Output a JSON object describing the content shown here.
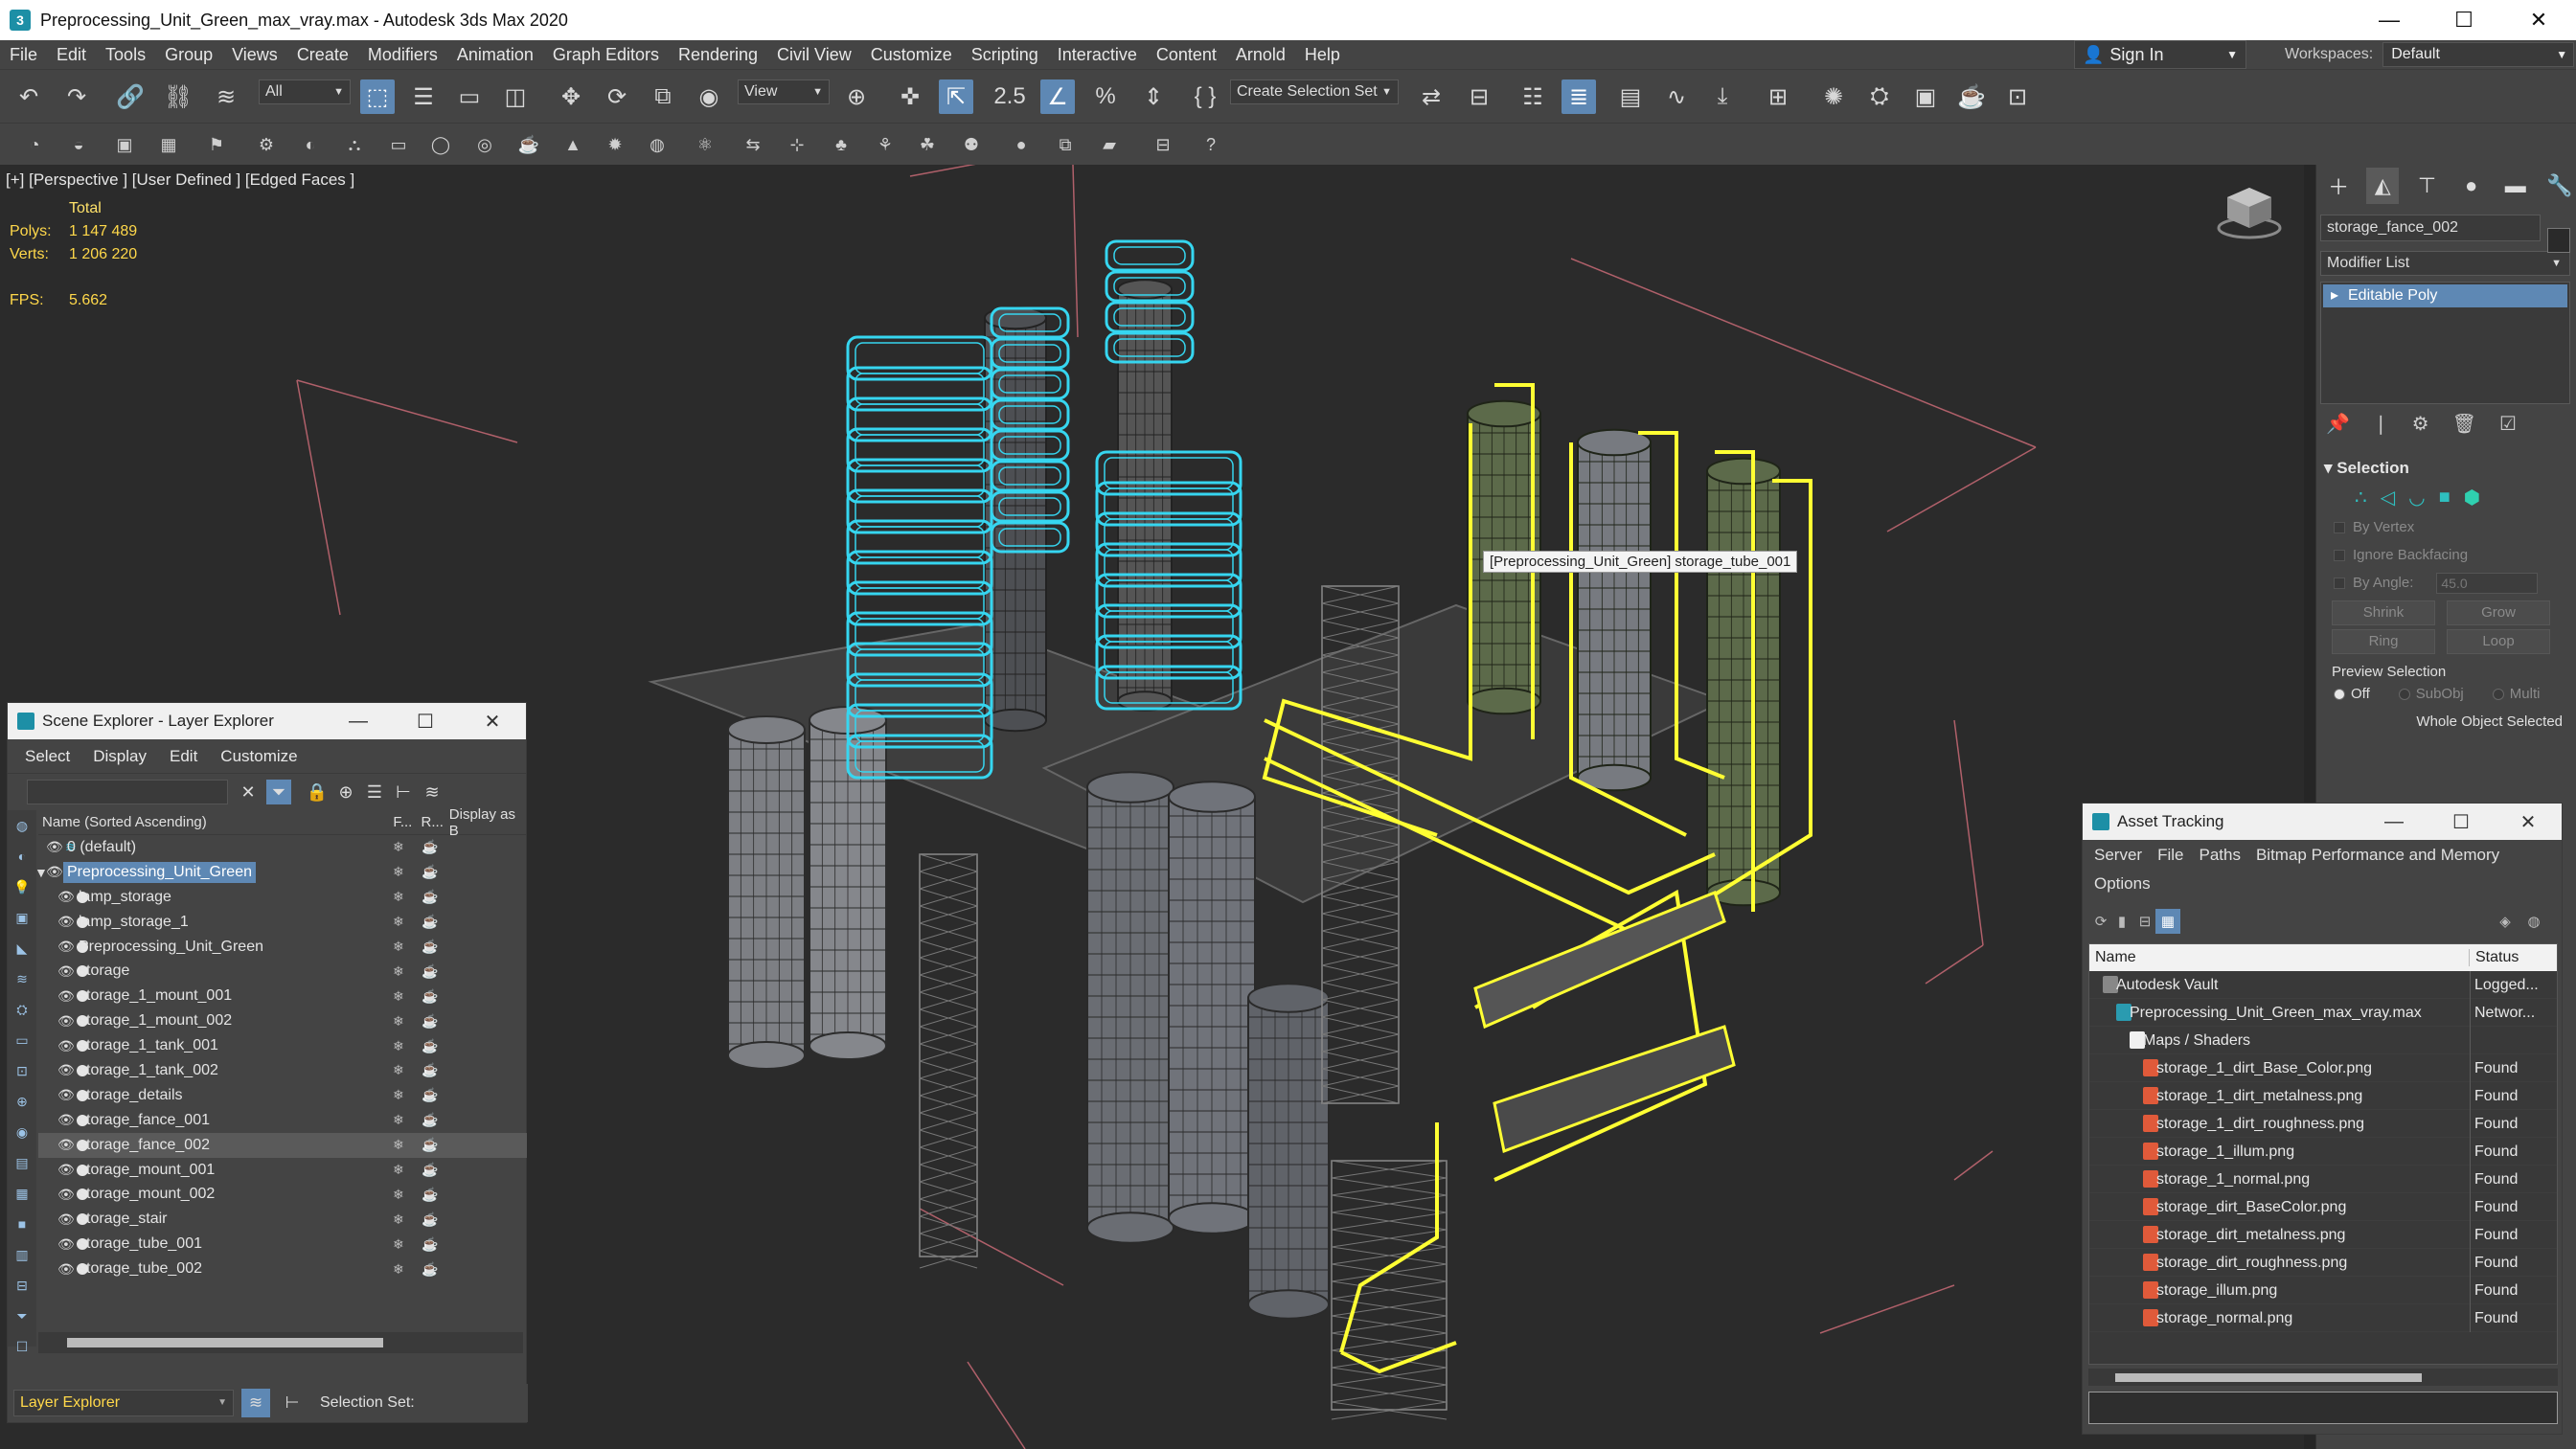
{
  "window": {
    "title": "Preprocessing_Unit_Green_max_vray.max - Autodesk 3ds Max 2020",
    "minimize": "—",
    "maximize": "☐",
    "close": "✕"
  },
  "menubar": {
    "items": [
      "File",
      "Edit",
      "Tools",
      "Group",
      "Views",
      "Create",
      "Modifiers",
      "Animation",
      "Graph Editors",
      "Rendering",
      "Civil View",
      "Customize",
      "Scripting",
      "Interactive",
      "Content",
      "Arnold",
      "Help"
    ],
    "sign_in": "Sign In",
    "workspaces_label": "Workspaces:",
    "workspaces_value": "Default"
  },
  "toolbar": {
    "filter_value": "All",
    "view_value": "View",
    "selection_set_placeholder": "Create Selection Set"
  },
  "viewport": {
    "label": "[+] [Perspective ] [User Defined ] [Edged Faces ]",
    "stats_header": "Total",
    "polys_label": "Polys:",
    "polys_value": "1 147 489",
    "verts_label": "Verts:",
    "verts_value": "1 206 220",
    "fps_label": "FPS:",
    "fps_value": "5.662",
    "tooltip": "[Preprocessing_Unit_Green] storage_tube_001"
  },
  "command_panel": {
    "object_name": "storage_fance_002",
    "modifier_list": "Modifier List",
    "stack_item": "Editable Poly",
    "selection_title": "Selection",
    "by_vertex": "By Vertex",
    "ignore_backfacing": "Ignore Backfacing",
    "by_angle": "By Angle:",
    "by_angle_value": "45.0",
    "shrink": "Shrink",
    "grow": "Grow",
    "ring": "Ring",
    "loop": "Loop",
    "preview_selection": "Preview Selection",
    "preview_off": "Off",
    "preview_subobj": "SubObj",
    "preview_multi": "Multi",
    "whole_object": "Whole Object Selected"
  },
  "scene_explorer": {
    "title": "Scene Explorer - Layer Explorer",
    "menu": [
      "Select",
      "Display",
      "Edit",
      "Customize"
    ],
    "columns": {
      "name": "Name (Sorted Ascending)",
      "frozen": "F...",
      "render": "R...",
      "display": "Display as B"
    },
    "rows": [
      {
        "name": "0 (default)",
        "level": 0
      },
      {
        "name": "Preprocessing_Unit_Green",
        "level": 0
      },
      {
        "name": "lamp_storage",
        "level": 1
      },
      {
        "name": "lamp_storage_1",
        "level": 1
      },
      {
        "name": "Preprocessing_Unit_Green",
        "level": 1
      },
      {
        "name": "storage",
        "level": 1
      },
      {
        "name": "storage_1_mount_001",
        "level": 1
      },
      {
        "name": "storage_1_mount_002",
        "level": 1
      },
      {
        "name": "storage_1_tank_001",
        "level": 1
      },
      {
        "name": "storage_1_tank_002",
        "level": 1
      },
      {
        "name": "storage_details",
        "level": 1
      },
      {
        "name": "storage_fance_001",
        "level": 1
      },
      {
        "name": "storage_fance_002",
        "level": 1
      },
      {
        "name": "storage_mount_001",
        "level": 1
      },
      {
        "name": "storage_mount_002",
        "level": 1
      },
      {
        "name": "storage_stair",
        "level": 1
      },
      {
        "name": "storage_tube_001",
        "level": 1
      },
      {
        "name": "storage_tube_002",
        "level": 1
      }
    ],
    "selected_row": 1,
    "highlight_row": 12,
    "footer_value": "Layer Explorer",
    "selection_set_label": "Selection Set:"
  },
  "asset_tracking": {
    "title": "Asset Tracking",
    "menu": [
      "Server",
      "File",
      "Paths",
      "Bitmap Performance and Memory",
      "Options"
    ],
    "columns": {
      "name": "Name",
      "status": "Status"
    },
    "rows": [
      {
        "name": "Autodesk Vault",
        "status": "Logged...",
        "level": 0,
        "kind": "vault"
      },
      {
        "name": "Preprocessing_Unit_Green_max_vray.max",
        "status": "Networ...",
        "level": 1,
        "kind": "max"
      },
      {
        "name": "Maps / Shaders",
        "status": "",
        "level": 2,
        "kind": "folder"
      },
      {
        "name": "storage_1_dirt_Base_Color.png",
        "status": "Found",
        "level": 3,
        "kind": "png"
      },
      {
        "name": "storage_1_dirt_metalness.png",
        "status": "Found",
        "level": 3,
        "kind": "png"
      },
      {
        "name": "storage_1_dirt_roughness.png",
        "status": "Found",
        "level": 3,
        "kind": "png"
      },
      {
        "name": "storage_1_illum.png",
        "status": "Found",
        "level": 3,
        "kind": "png"
      },
      {
        "name": "storage_1_normal.png",
        "status": "Found",
        "level": 3,
        "kind": "png"
      },
      {
        "name": "storage_dirt_BaseColor.png",
        "status": "Found",
        "level": 3,
        "kind": "png"
      },
      {
        "name": "storage_dirt_metalness.png",
        "status": "Found",
        "level": 3,
        "kind": "png"
      },
      {
        "name": "storage_dirt_roughness.png",
        "status": "Found",
        "level": 3,
        "kind": "png"
      },
      {
        "name": "storage_illum.png",
        "status": "Found",
        "level": 3,
        "kind": "png"
      },
      {
        "name": "storage_normal.png",
        "status": "Found",
        "level": 3,
        "kind": "png"
      }
    ]
  },
  "colors": {
    "accent": "#5e88b4",
    "selection_wire": "#ffff33",
    "frozen_wire": "#36d6f0",
    "stats_text": "#ffd84a"
  }
}
